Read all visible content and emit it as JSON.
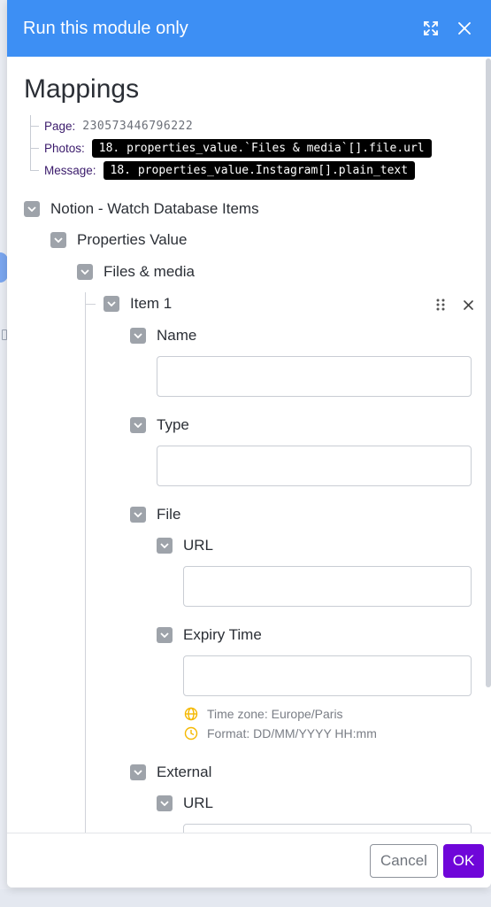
{
  "dialog": {
    "title": "Run this module only",
    "expand_icon": "expand-arrows-icon",
    "close_icon": "close-icon"
  },
  "mappings": {
    "heading": "Mappings",
    "rows": [
      {
        "label": "Page:",
        "value": "230573446796222",
        "style": "plain"
      },
      {
        "label": "Photos:",
        "value": "18. properties_value.`Files & media`[].file.url",
        "style": "pill"
      },
      {
        "label": "Message:",
        "value": "18. properties_value.Instagram[].plain_text",
        "style": "pill"
      }
    ]
  },
  "tree": {
    "root": "Notion - Watch Database Items",
    "properties_value": "Properties Value",
    "files_media": "Files & media",
    "item": "Item 1",
    "name": "Name",
    "type": "Type",
    "file": "File",
    "url": "URL",
    "expiry_time": "Expiry Time",
    "timezone_hint": "Time zone: Europe/Paris",
    "format_hint": "Format: DD/MM/YYYY HH:mm",
    "external": "External",
    "external_url": "URL",
    "fields": {
      "name_value": "",
      "type_value": "",
      "url_value": "",
      "expiry_value": "",
      "external_url_value": ""
    }
  },
  "footer": {
    "cancel_label": "Cancel",
    "ok_label": "OK"
  },
  "colors": {
    "titlebar": "#3d8ff4",
    "ok_button": "#6f06d9",
    "checkbox": "#9ea3aa",
    "hint_icon": "#f5b800"
  }
}
